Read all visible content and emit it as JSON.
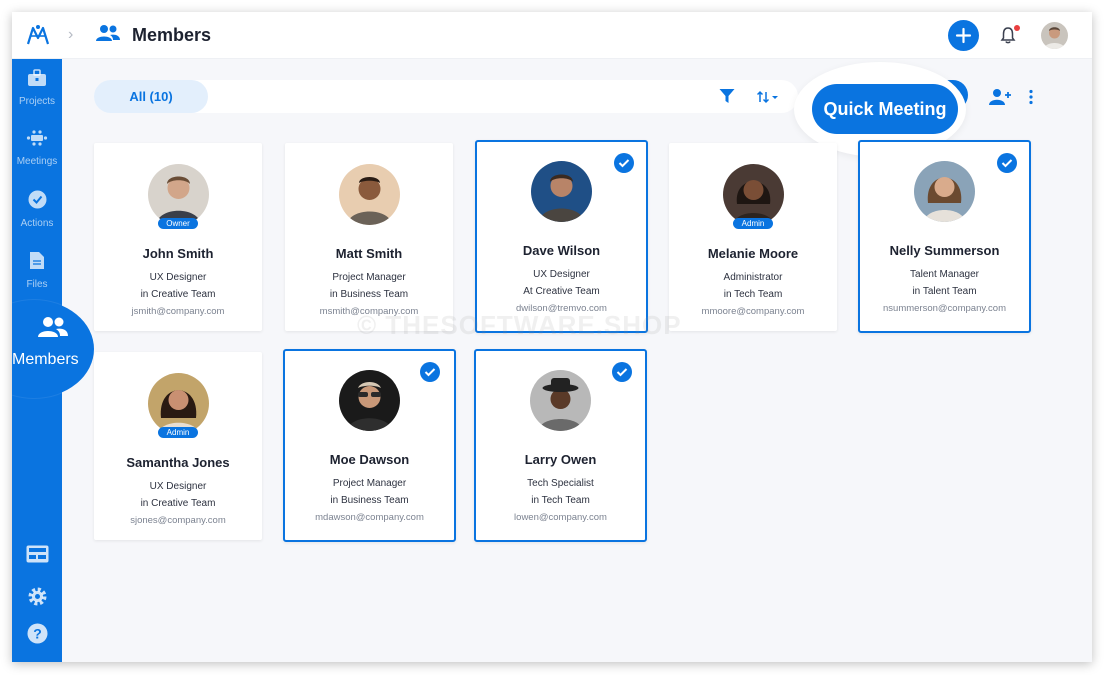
{
  "header": {
    "title": "Members"
  },
  "sidebar": {
    "items": [
      {
        "label": "Projects"
      },
      {
        "label": "Meetings"
      },
      {
        "label": "Actions"
      },
      {
        "label": "Files"
      },
      {
        "label": "Members"
      }
    ]
  },
  "toolbar": {
    "tab_all": "All (10)",
    "quick_meeting": "Quick Meeting"
  },
  "members": [
    {
      "name": "John Smith",
      "role": "UX Designer",
      "team": "in Creative Team",
      "email": "jsmith@company.com",
      "badge": "Owner",
      "selected": false
    },
    {
      "name": "Matt Smith",
      "role": "Project Manager",
      "team": "in Business Team",
      "email": "msmith@company.com",
      "badge": "",
      "selected": false
    },
    {
      "name": "Dave Wilson",
      "role": "UX Designer",
      "team": "At Creative Team",
      "email": "dwilson@tremvo.com",
      "badge": "",
      "selected": true
    },
    {
      "name": "Melanie Moore",
      "role": "Administrator",
      "team": "in Tech Team",
      "email": "mmoore@company.com",
      "badge": "Admin",
      "selected": false
    },
    {
      "name": "Nelly Summerson",
      "role": "Talent Manager",
      "team": "in Talent Team",
      "email": "nsummerson@company.com",
      "badge": "",
      "selected": true
    },
    {
      "name": "Samantha Jones",
      "role": "UX Designer",
      "team": "in Creative Team",
      "email": "sjones@company.com",
      "badge": "Admin",
      "selected": false
    },
    {
      "name": "Moe Dawson",
      "role": "Project Manager",
      "team": "in Business Team",
      "email": "mdawson@company.com",
      "badge": "",
      "selected": true
    },
    {
      "name": "Larry Owen",
      "role": "Tech Specialist",
      "team": "in Tech Team",
      "email": "lowen@company.com",
      "badge": "",
      "selected": true
    }
  ],
  "watermark": "© THESOFTWARE.SHOP",
  "colors": {
    "accent": "#0a74e0",
    "notification": "#ea3f3f"
  }
}
